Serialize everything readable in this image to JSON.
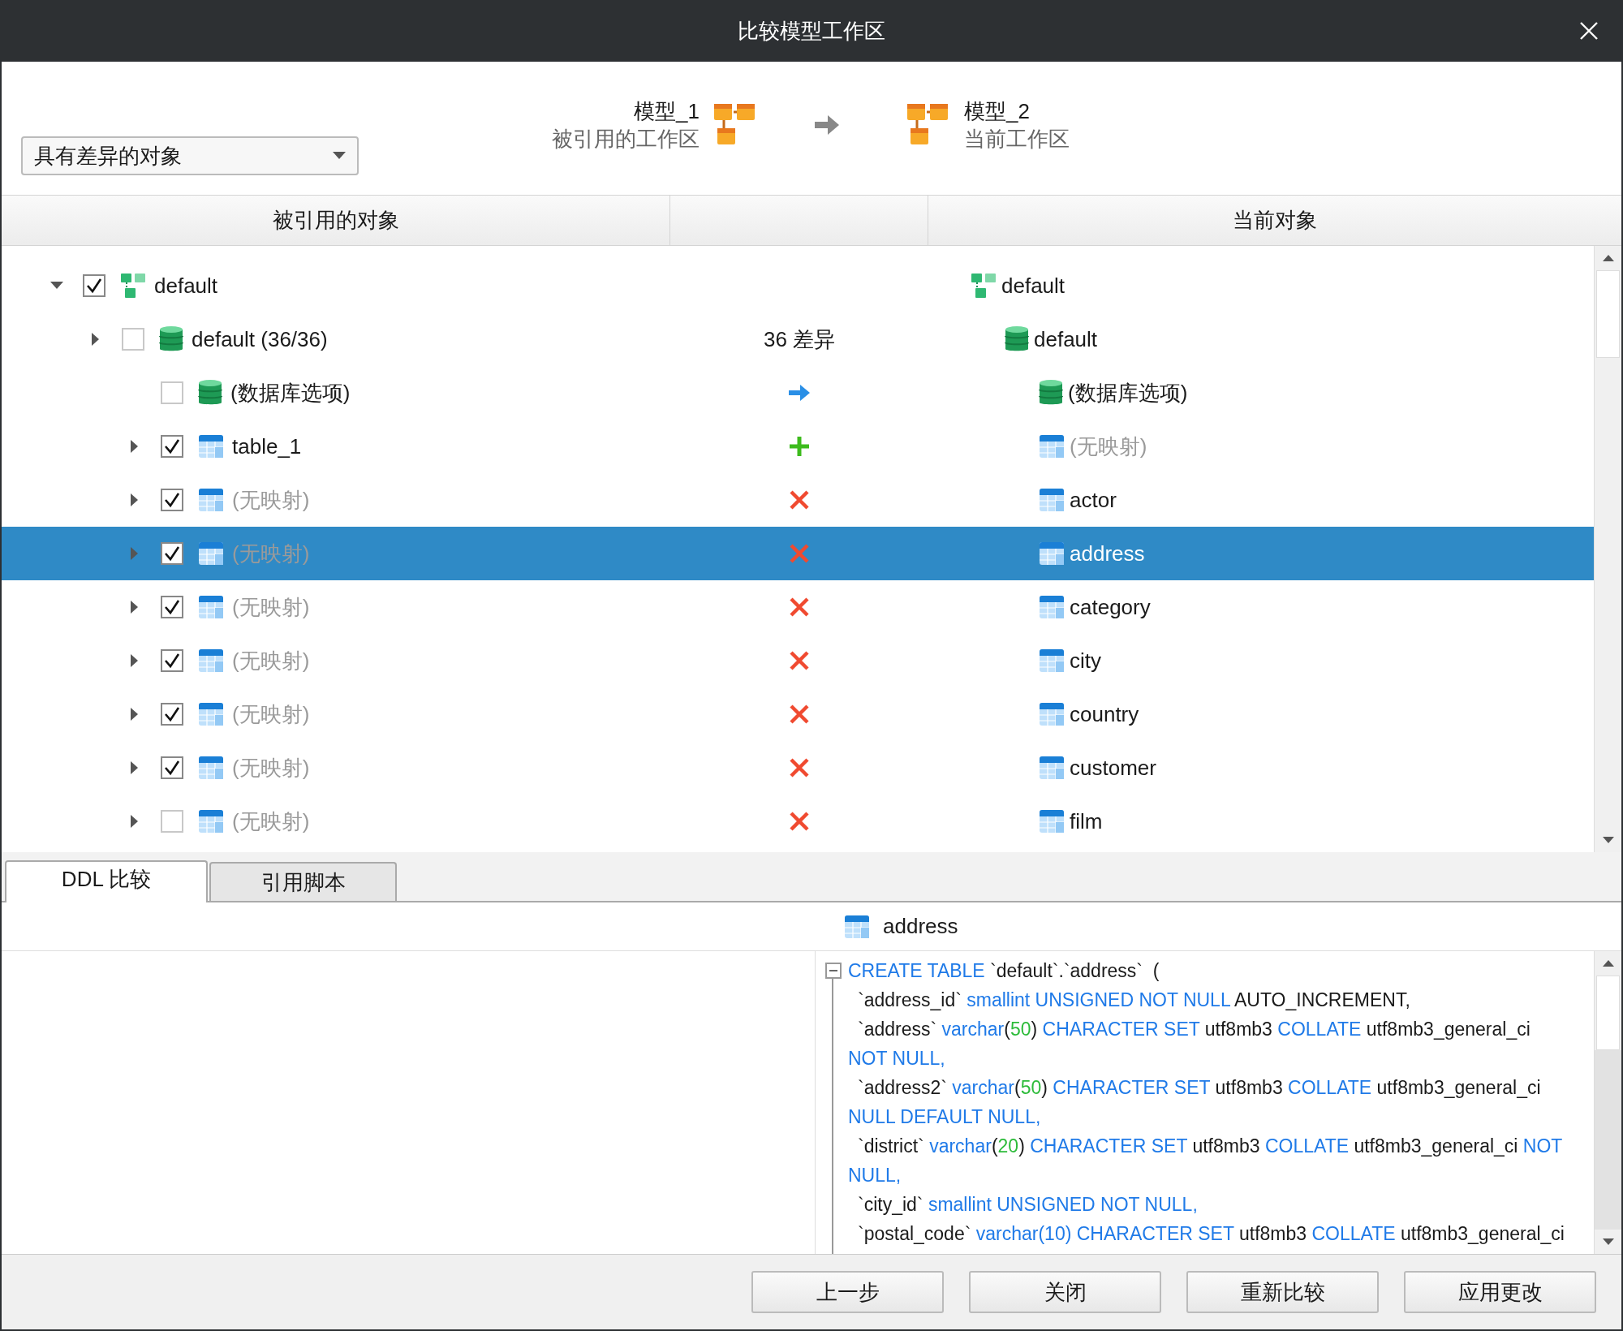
{
  "window": {
    "title": "比较模型工作区"
  },
  "filter": {
    "value": "具有差异的对象"
  },
  "source": {
    "name": "模型_1",
    "caption": "被引用的工作区"
  },
  "target": {
    "name": "模型_2",
    "caption": "当前工作区"
  },
  "columns": [
    "被引用的对象",
    "当前对象"
  ],
  "tree": [
    {
      "label": "default",
      "kind": "model",
      "checked": true,
      "expanded": true,
      "selected": false,
      "muted": false,
      "right": {
        "label": "default",
        "kind": "model",
        "muted": false
      },
      "children": [
        {
          "label": "default (36/36)",
          "kind": "database",
          "checked": false,
          "expanded": false,
          "selected": false,
          "muted": false,
          "diff": {
            "kind": "text",
            "text": "36 差异"
          },
          "right": {
            "label": "default",
            "kind": "database",
            "muted": false
          },
          "children": [
            {
              "label": "(数据库选项)",
              "kind": "database",
              "checked": false,
              "selected": false,
              "muted": false,
              "diff": {
                "kind": "arrow"
              },
              "right": {
                "label": "(数据库选项)",
                "kind": "database",
                "muted": false
              }
            },
            {
              "label": "table_1",
              "kind": "table",
              "checked": true,
              "expanded": false,
              "selected": false,
              "muted": false,
              "diff": {
                "kind": "add"
              },
              "right": {
                "label": "(无映射)",
                "kind": "table",
                "muted": true
              }
            },
            {
              "label": "(无映射)",
              "kind": "table",
              "checked": true,
              "expanded": false,
              "selected": false,
              "muted": true,
              "diff": {
                "kind": "remove"
              },
              "right": {
                "label": "actor",
                "kind": "table",
                "muted": false
              }
            },
            {
              "label": "(无映射)",
              "kind": "table",
              "checked": true,
              "expanded": false,
              "selected": true,
              "muted": true,
              "diff": {
                "kind": "remove"
              },
              "right": {
                "label": "address",
                "kind": "table",
                "muted": false
              }
            },
            {
              "label": "(无映射)",
              "kind": "table",
              "checked": true,
              "expanded": false,
              "selected": false,
              "muted": true,
              "diff": {
                "kind": "remove"
              },
              "right": {
                "label": "category",
                "kind": "table",
                "muted": false
              }
            },
            {
              "label": "(无映射)",
              "kind": "table",
              "checked": true,
              "expanded": false,
              "selected": false,
              "muted": true,
              "diff": {
                "kind": "remove"
              },
              "right": {
                "label": "city",
                "kind": "table",
                "muted": false
              }
            },
            {
              "label": "(无映射)",
              "kind": "table",
              "checked": true,
              "expanded": false,
              "selected": false,
              "muted": true,
              "diff": {
                "kind": "remove"
              },
              "right": {
                "label": "country",
                "kind": "table",
                "muted": false
              }
            },
            {
              "label": "(无映射)",
              "kind": "table",
              "checked": true,
              "expanded": false,
              "selected": false,
              "muted": true,
              "diff": {
                "kind": "remove"
              },
              "right": {
                "label": "customer",
                "kind": "table",
                "muted": false
              }
            },
            {
              "label": "(无映射)",
              "kind": "table",
              "checked": false,
              "expanded": false,
              "selected": false,
              "muted": true,
              "diff": {
                "kind": "remove"
              },
              "right": {
                "label": "film",
                "kind": "table",
                "muted": false
              }
            }
          ]
        }
      ]
    }
  ],
  "tabs": [
    {
      "label": "DDL 比较",
      "selected": true
    },
    {
      "label": "引用脚本",
      "selected": false
    }
  ],
  "ddl": {
    "object": "address",
    "lines": [
      {
        "fold": true,
        "text": "**CREATE TABLE** `default`.`address`  ("
      },
      {
        "indent": true,
        "text": "`address_id` **smallint UNSIGNED NOT NULL** AUTO_INCREMENT,"
      },
      {
        "indent": true,
        "text": "`address` **varchar**(*50*) **CHARACTER SET** utf8mb3 **COLLATE** utf8mb3_general_ci"
      },
      {
        "text": "**NOT NULL,**"
      },
      {
        "indent": true,
        "text": "`address2` **varchar**(*50*) **CHARACTER SET** utf8mb3 **COLLATE** utf8mb3_general_ci"
      },
      {
        "text": "**NULL DEFAULT NULL,**"
      },
      {
        "indent": true,
        "text": "`district` **varchar**(*20*) **CHARACTER SET** utf8mb3 **COLLATE** utf8mb3_general_ci **NOT**"
      },
      {
        "text": "**NULL,**"
      },
      {
        "indent": true,
        "text": "`city_id` **smallint UNSIGNED NOT NULL,**"
      },
      {
        "indent": true,
        "text": "`postal_code` **varchar(10) CHARACTER SET** utf8mb3 **COLLATE** utf8mb3_general_ci"
      }
    ]
  },
  "buttons": [
    "上一步",
    "关闭",
    "重新比较",
    "应用更改"
  ]
}
